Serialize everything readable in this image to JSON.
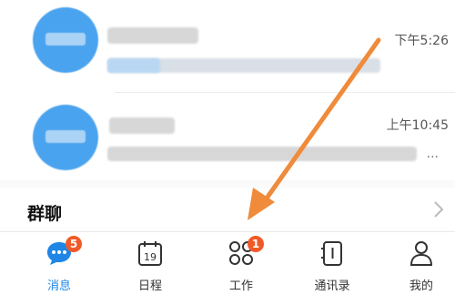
{
  "chats": [
    {
      "time": "下午5:26"
    },
    {
      "time": "上午10:45",
      "preview_tail": "..."
    }
  ],
  "section": {
    "title": "群聊"
  },
  "tabs": [
    {
      "label": "消息",
      "icon": "chat-bubble-icon",
      "badge": "5",
      "active": true
    },
    {
      "label": "日程",
      "icon": "calendar-icon",
      "calendar_day": "19"
    },
    {
      "label": "工作",
      "icon": "apps-grid-icon",
      "badge": "1"
    },
    {
      "label": "通讯录",
      "icon": "contacts-icon"
    },
    {
      "label": "我的",
      "icon": "person-icon"
    }
  ],
  "colors": {
    "accent": "#1f86e6",
    "badge": "#f05a28",
    "annotation_arrow": "#ef8b3a"
  }
}
